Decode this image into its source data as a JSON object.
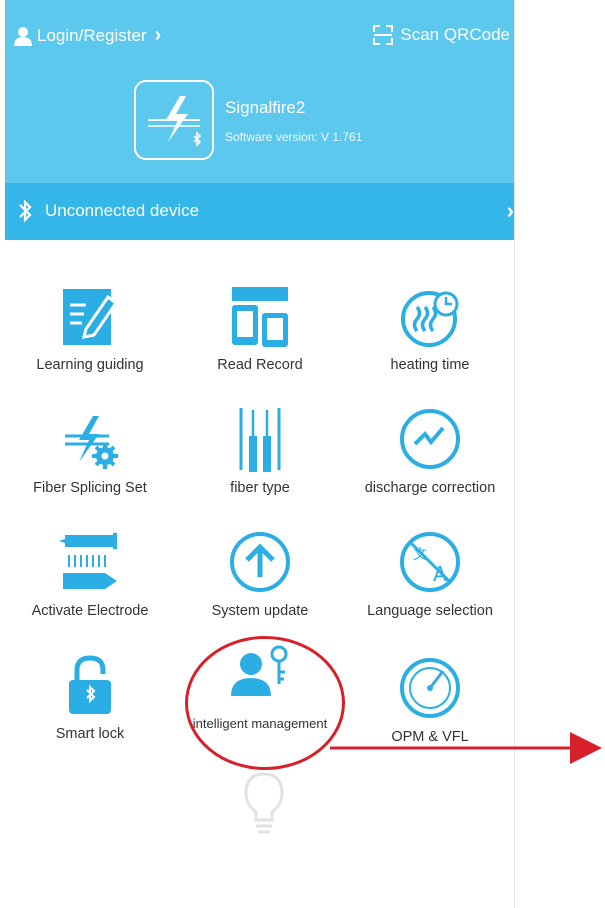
{
  "header": {
    "login_label": "Login/Register",
    "scan_label": "Scan QRCode",
    "app_name": "Signalfire2",
    "software_version": "Software version: V 1.761"
  },
  "device_bar": {
    "status": "Unconnected device"
  },
  "menu": {
    "items": [
      {
        "label": "Learning guiding"
      },
      {
        "label": "Read Record"
      },
      {
        "label": "heating time"
      },
      {
        "label": "Fiber Splicing Set"
      },
      {
        "label": "fiber type"
      },
      {
        "label": "discharge correction"
      },
      {
        "label": "Activate Electrode"
      },
      {
        "label": "System update"
      },
      {
        "label": "Language selection"
      },
      {
        "label": "Smart lock"
      },
      {
        "label": "intelligent management"
      },
      {
        "label": "OPM & VFL"
      }
    ]
  },
  "colors": {
    "header_bg": "#5cc8ee",
    "device_bar_bg": "#34b6e8",
    "icon_accent": "#2aaee3",
    "annotation_red": "#d8202a"
  }
}
